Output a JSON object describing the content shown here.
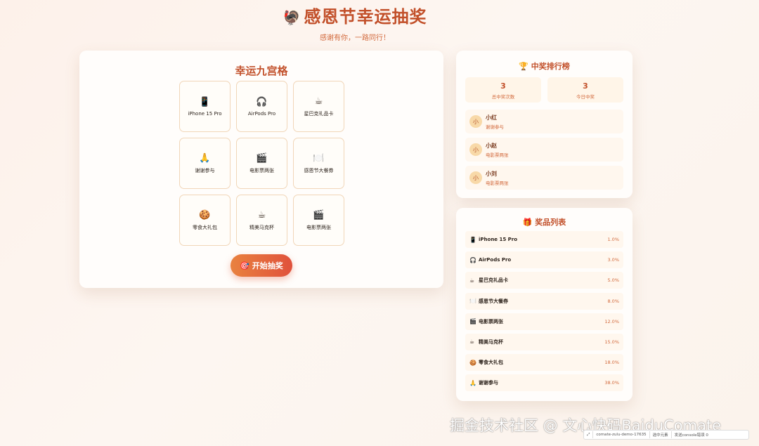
{
  "header": {
    "icon": "turkey-icon",
    "icon_glyph": "🦃",
    "title": "感恩节幸运抽奖",
    "subtitle": "感谢有你，一路同行！"
  },
  "lottery": {
    "title": "幸运九宫格",
    "cells": [
      {
        "emoji": "📱",
        "label": "iPhone 15 Pro"
      },
      {
        "emoji": "🎧",
        "label": "AirPods Pro"
      },
      {
        "emoji": "☕",
        "label": "星巴克礼品卡"
      },
      {
        "emoji": "🙏",
        "label": "谢谢参与"
      },
      {
        "emoji": "🎬",
        "label": "电影票两张"
      },
      {
        "emoji": "🍽️",
        "label": "感恩节大餐券"
      },
      {
        "emoji": "🍪",
        "label": "零食大礼包"
      },
      {
        "emoji": "☕",
        "label": "精美马克杯"
      },
      {
        "emoji": "🎬",
        "label": "电影票两张"
      }
    ],
    "start_button": "🎯 开始抽奖"
  },
  "ranking": {
    "title": "🏆 中奖排行榜",
    "stats": [
      {
        "value": "3",
        "label": "总中奖次数"
      },
      {
        "value": "3",
        "label": "今日中奖"
      }
    ],
    "winners": [
      {
        "avatar": "小",
        "name": "小红",
        "prize": "谢谢参与"
      },
      {
        "avatar": "小",
        "name": "小赵",
        "prize": "电影票两张"
      },
      {
        "avatar": "小",
        "name": "小刘",
        "prize": "电影票两张"
      }
    ]
  },
  "prizes": {
    "title": "🎁 奖品列表",
    "items": [
      {
        "icon": "📱",
        "name": "iPhone 15 Pro",
        "prob": "1.0%"
      },
      {
        "icon": "🎧",
        "name": "AirPods Pro",
        "prob": "3.0%"
      },
      {
        "icon": "☕",
        "name": "星巴克礼品卡",
        "prob": "5.0%"
      },
      {
        "icon": "🍽️",
        "name": "感恩节大餐券",
        "prob": "8.0%"
      },
      {
        "icon": "🎬",
        "name": "电影票两张",
        "prob": "12.0%"
      },
      {
        "icon": "☕",
        "name": "精美马克杯",
        "prob": "15.0%"
      },
      {
        "icon": "🍪",
        "name": "零食大礼包",
        "prob": "18.0%"
      },
      {
        "icon": "🙏",
        "name": "谢谢参与",
        "prob": "38.0%"
      }
    ]
  },
  "watermark": "掘金技术社区 @ 文心快码BaiduComate",
  "devbar": {
    "tab": "comate-zulu-demo-17635",
    "select": "选中元素",
    "console": "发送console错误 0"
  }
}
